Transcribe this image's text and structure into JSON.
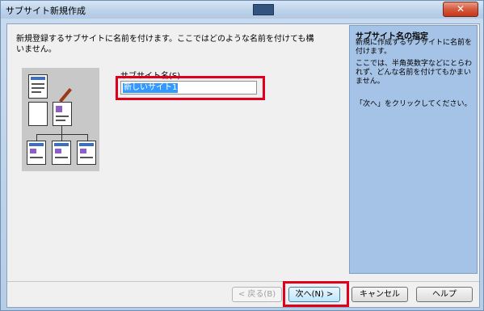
{
  "window": {
    "title": "サブサイト新規作成",
    "close_glyph": "✕"
  },
  "description": "新規登録するサブサイトに名前を付けます。ここではどのような名前を付けても構いません。",
  "name_field": {
    "label": "サブサイト名(S)",
    "value": "新しいサイト1"
  },
  "help": {
    "title": "サブサイト名の指定",
    "paragraphs": [
      "新規に作成するサブサイトに名前を付けます。",
      "ここでは、半角英数字などにとらわれず、どんな名前を付けてもかまいません。",
      "「次へ」をクリックしてください。"
    ]
  },
  "buttons": {
    "back": "< 戻る(B)",
    "next": "次へ(N) >",
    "cancel": "キャンセル",
    "help": "ヘルプ"
  }
}
